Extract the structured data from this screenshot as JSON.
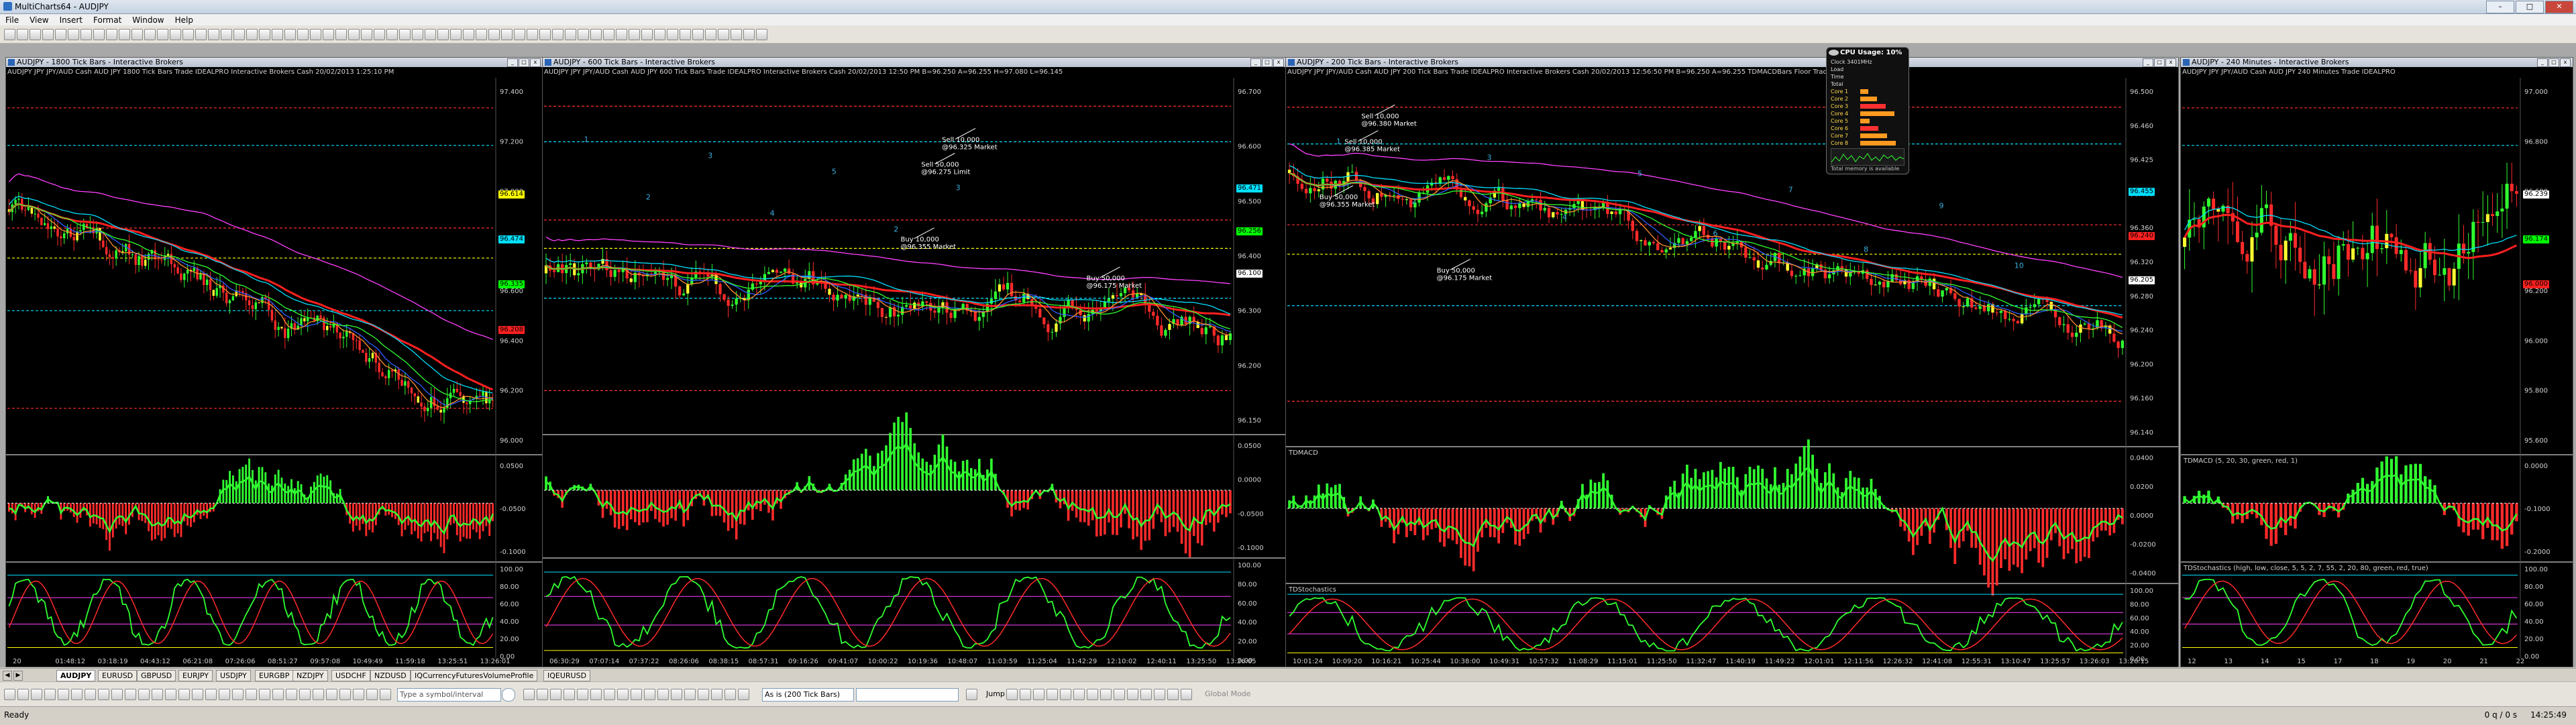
{
  "app": {
    "title": "MultiCharts64 - AUDJPY",
    "menu": [
      "File",
      "View",
      "Insert",
      "Format",
      "Window",
      "Help"
    ]
  },
  "cpu_widget": {
    "title": "CPU Usage: 10%",
    "lines": [
      "Clock 3401MHz",
      "Load",
      "Time",
      "Total",
      "Core 1",
      "Core 2",
      "Core 3",
      "Core 4",
      "Core 5",
      "Core 6",
      "Core 7",
      "Core 8"
    ],
    "footer": "Total memory is available"
  },
  "charts": [
    {
      "title": "AUDJPY - 1800 Tick Bars - Interactive Brokers",
      "series_info": "AUDJPY  JPY JPY/AUD Cash AUD JPY  1800 Tick Bars  Trade  IDEALPRO  Interactive Brokers  Cash  20/02/2013  1:25:10 PM",
      "price_axis": [
        "97.400",
        "97.200",
        "97.000",
        "96.800",
        "96.600",
        "96.400",
        "96.200",
        "96.000"
      ],
      "macd_axis": [
        "0.0500",
        "-0.0500",
        "-0.1000"
      ],
      "stoch_axis": [
        "100.00",
        "80.00",
        "60.00",
        "40.00",
        "20.00",
        "0.00"
      ],
      "time_axis": [
        "20",
        "01:48:12",
        "03:18:19",
        "04:43:12",
        "06:21:08",
        "07:26:06",
        "08:51:27",
        "09:57:08",
        "10:49:49",
        "11:59:18",
        "13:25:51",
        "13:26:01"
      ],
      "price_boxes": [
        {
          "value": "96.614",
          "color": "#ffff00"
        },
        {
          "value": "96.474",
          "color": "#00e0ff"
        },
        {
          "value": "96.335",
          "color": "#00ff00"
        },
        {
          "value": "96.208",
          "color": "#ff2020"
        }
      ],
      "annotations": []
    },
    {
      "title": "AUDJPY - 600 Tick Bars - Interactive Brokers",
      "series_info": "AUDJPY  JPY JPY/AUD Cash AUD JPY  600 Tick Bars  Trade  IDEALPRO  Interactive Brokers  Cash  20/02/2013  12:50 PM  B=96.250  A=96.255  H=97.080  L=96.145",
      "price_axis": [
        "96.700",
        "96.600",
        "96.500",
        "96.400",
        "96.300",
        "96.200",
        "96.150"
      ],
      "macd_axis": [
        "0.0500",
        "0.0000",
        "-0.0500",
        "-0.1000"
      ],
      "stoch_axis": [
        "100.00",
        "80.00",
        "60.00",
        "40.00",
        "20.00",
        "0.00"
      ],
      "time_axis": [
        "06:30:29",
        "07:07:14",
        "07:37:22",
        "08:26:06",
        "08:38:15",
        "08:57:31",
        "09:16:26",
        "09:41:07",
        "10:00:22",
        "10:19:36",
        "10:48:07",
        "11:03:59",
        "11:25:04",
        "11:42:29",
        "12:10:02",
        "12:40:11",
        "13:25:50",
        "13:26:05"
      ],
      "price_boxes": [
        {
          "value": "96.471",
          "color": "#00e0ff"
        },
        {
          "value": "96.256",
          "color": "#00ff00"
        },
        {
          "value": "96.100",
          "color": "#ffffff"
        }
      ],
      "annotations": [
        {
          "text": "Sell 10,000",
          "sub": "@96.325 Market"
        },
        {
          "text": "Sell 50,000",
          "sub": "@96.275 Limit"
        },
        {
          "text": "Buy 10,000",
          "sub": "@96.355 Market"
        },
        {
          "text": "Buy 50,000",
          "sub": "@96.175 Market"
        }
      ],
      "counts": [
        "1",
        "2",
        "3",
        "4",
        "5",
        "2",
        "3"
      ]
    },
    {
      "title": "AUDJPY - 200 Tick Bars - Interactive Brokers",
      "series_info": "AUDJPY  JPY JPY/AUD Cash AUD JPY  200 Tick Bars  Trade  IDEALPRO  Interactive Brokers  Cash  20/02/2013  12:56:50 PM  B=96.250  A=96.255  TDMACDBars  Floor Trader Pivots  TDS",
      "price_axis": [
        "96.500",
        "96.460",
        "96.425",
        "96.400",
        "96.360",
        "96.320",
        "96.280",
        "96.240",
        "96.200",
        "96.160",
        "96.140"
      ],
      "macd_label": "TDMACD",
      "macd_axis": [
        "0.0400",
        "0.0200",
        "0.0000",
        "-0.0200",
        "-0.0400"
      ],
      "stoch_label": "TDStochastics",
      "stoch_axis": [
        "100.00",
        "80.00",
        "60.00",
        "40.00",
        "20.00",
        "0.00"
      ],
      "time_axis": [
        "10:01:24",
        "10:09:20",
        "10:16:21",
        "10:25:44",
        "10:38:00",
        "10:49:31",
        "10:57:32",
        "11:08:29",
        "11:15:01",
        "11:25:50",
        "11:32:47",
        "11:40:19",
        "11:49:22",
        "12:01:01",
        "12:11:56",
        "12:26:32",
        "12:41:08",
        "12:55:31",
        "13:10:47",
        "13:25:57",
        "13:26:03",
        "13:26:15"
      ],
      "price_boxes": [
        {
          "value": "96.455",
          "color": "#00e0ff"
        },
        {
          "value": "96.240",
          "color": "#ff2020"
        },
        {
          "value": "96.205",
          "color": "#ffffff"
        }
      ],
      "annotations": [
        {
          "text": "Sell 10,000",
          "sub": "@96.380 Market"
        },
        {
          "text": "Sell 10,000",
          "sub": "@96.385 Market"
        },
        {
          "text": "Buy 50,000",
          "sub": "@96.355 Market"
        },
        {
          "text": "Buy 50,000",
          "sub": "@96.175 Market"
        }
      ],
      "counts": [
        "1",
        "2",
        "3",
        "4",
        "5",
        "6",
        "7",
        "8",
        "9",
        "10"
      ]
    },
    {
      "title": "AUDJPY - 240 Minutes - Interactive Brokers",
      "series_info": "AUDJPY  JPY JPY/AUD Cash AUD JPY  240 Minutes  Trade  IDEALPRO",
      "price_axis": [
        "97.000",
        "96.800",
        "96.600",
        "96.400",
        "96.200",
        "96.000",
        "95.800",
        "95.600"
      ],
      "macd_label": "TDMACD (5, 20, 30, green, red, 1)",
      "macd_axis": [
        "0.0000",
        "-0.1000",
        "-0.2000"
      ],
      "stoch_label": "TDStochastics (high, low, close, 5, 5, 2, 7, 55, 2, 20, 80, green, red, true)",
      "stoch_axis": [
        "100.00",
        "80.00",
        "60.00",
        "40.00",
        "20.00",
        "0.00"
      ],
      "time_axis": [
        "12",
        "13",
        "14",
        "15",
        "17",
        "18",
        "19",
        "20",
        "21",
        "22"
      ],
      "price_boxes": [
        {
          "value": "96.239",
          "color": "#ffffff"
        },
        {
          "value": "96.174",
          "color": "#00ff00"
        },
        {
          "value": "96.000",
          "color": "#ff2020"
        }
      ],
      "annotations": []
    }
  ],
  "sheet_tabs": [
    "AUDJPY",
    "EURUSD",
    "GBPUSD",
    "EURJPY",
    "USDJPY",
    "EURGBP",
    "NZDJPY",
    "USDCHF",
    "NZDUSD",
    "IQCurrencyFuturesVolumeProfile",
    "IQEURUSD"
  ],
  "bottom_toolbar": {
    "symbol_placeholder": "Type a symbol/interval",
    "resolution_value": "As is (200 Tick Bars)",
    "jump_label": "Jump",
    "global_mode_label": "Global Mode"
  },
  "status": {
    "left": "Ready",
    "counter": "0 q / 0 s",
    "time": "14:25:49"
  }
}
